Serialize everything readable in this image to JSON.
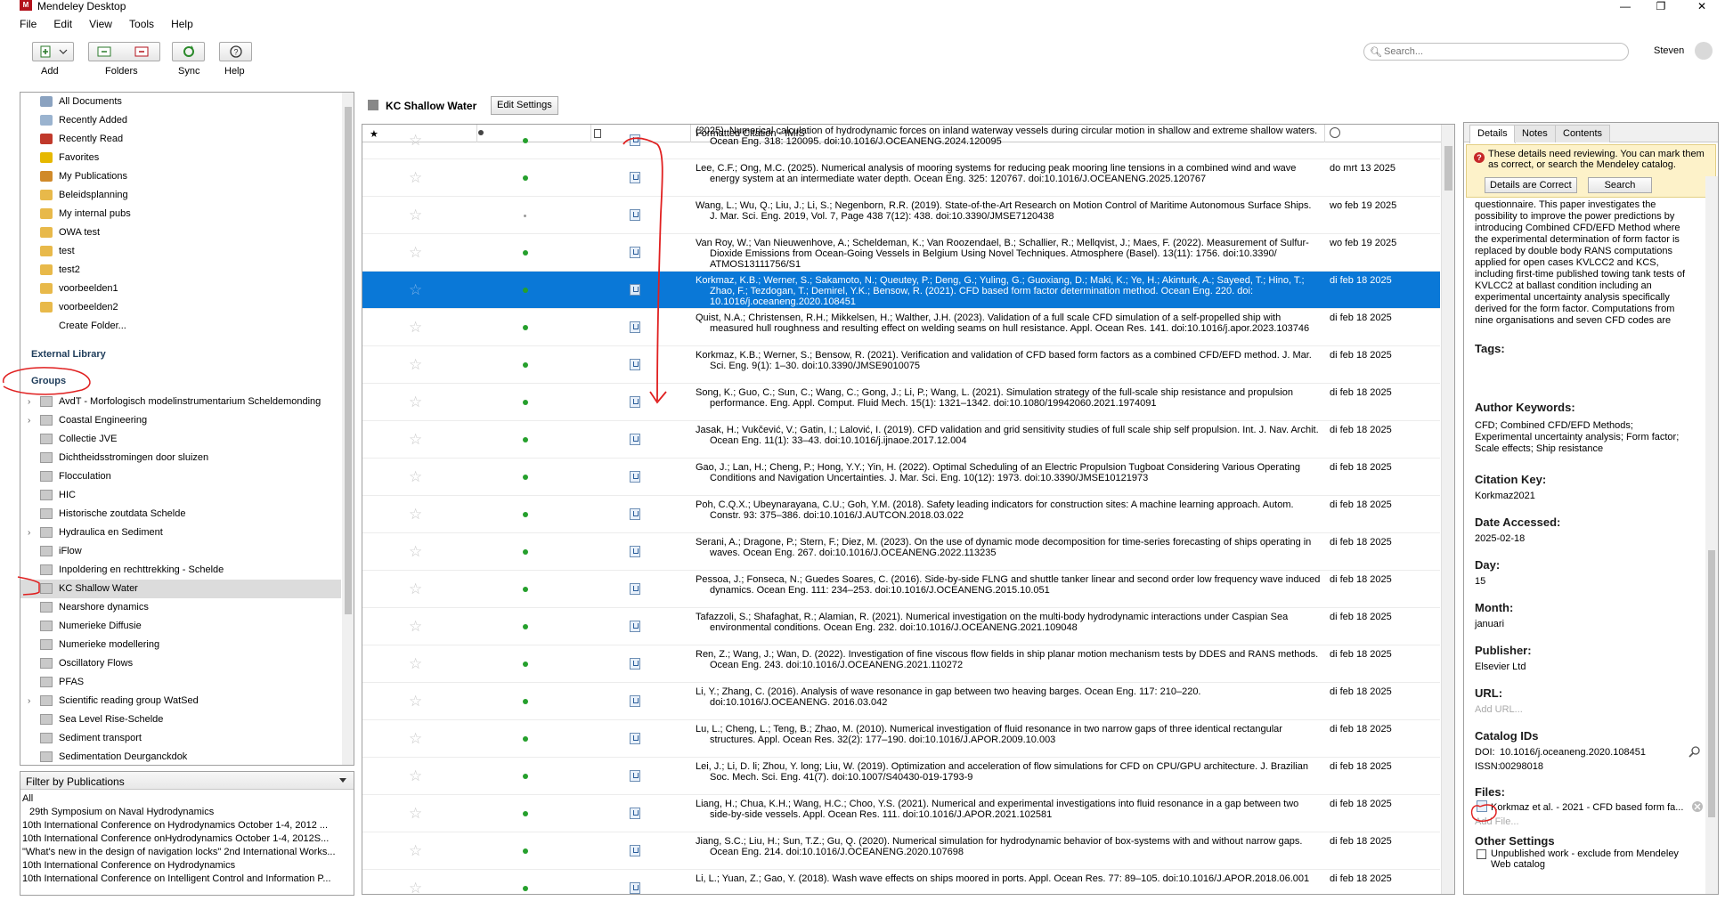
{
  "window": {
    "title": "Mendeley Desktop",
    "controls": [
      "—",
      "❐",
      "✕"
    ]
  },
  "menu": [
    "File",
    "Edit",
    "View",
    "Tools",
    "Help"
  ],
  "toolbar": {
    "add": "Add",
    "folders": "Folders",
    "sync": "Sync",
    "help": "Help"
  },
  "search": {
    "placeholder": "Search..."
  },
  "user": {
    "name": "Steven"
  },
  "sidebar": {
    "library_items": [
      {
        "label": "All Documents",
        "icon": "documents-icon"
      },
      {
        "label": "Recently Added",
        "icon": "clock-icon"
      },
      {
        "label": "Recently Read",
        "icon": "book-icon"
      },
      {
        "label": "Favorites",
        "icon": "star-icon"
      },
      {
        "label": "My Publications",
        "icon": "person-icon"
      },
      {
        "label": "Beleidsplanning",
        "icon": "folder-icon"
      },
      {
        "label": "My internal pubs",
        "icon": "folder-icon"
      },
      {
        "label": "OWA test",
        "icon": "folder-icon"
      },
      {
        "label": "test",
        "icon": "folder-icon"
      },
      {
        "label": "test2",
        "icon": "folder-icon"
      },
      {
        "label": "voorbeelden1",
        "icon": "folder-icon"
      },
      {
        "label": "voorbeelden2",
        "icon": "folder-icon"
      }
    ],
    "create_folder": "Create Folder...",
    "external_library": "External Library",
    "groups_heading": "Groups",
    "groups": [
      {
        "label": "AvdT - Morfologisch modelinstrumentarium Scheldemonding",
        "expand": true
      },
      {
        "label": "Coastal Engineering",
        "expand": true
      },
      {
        "label": "Collectie JVE",
        "expand": false
      },
      {
        "label": "Dichtheidsstromingen door sluizen",
        "expand": false
      },
      {
        "label": "Flocculation",
        "expand": false
      },
      {
        "label": "HIC",
        "expand": false
      },
      {
        "label": "Historische zoutdata Schelde",
        "expand": false
      },
      {
        "label": "Hydraulica en Sediment",
        "expand": true
      },
      {
        "label": "iFlow",
        "expand": false
      },
      {
        "label": "Inpoldering en rechttrekking - Schelde",
        "expand": false
      },
      {
        "label": "KC Shallow Water",
        "expand": false
      },
      {
        "label": "Nearshore dynamics",
        "expand": false
      },
      {
        "label": "Numerieke Diffusie",
        "expand": false
      },
      {
        "label": "Numerieke modellering",
        "expand": false
      },
      {
        "label": "Oscillatory Flows",
        "expand": false
      },
      {
        "label": "PFAS",
        "expand": false
      },
      {
        "label": "Scientific reading group WatSed",
        "expand": true
      },
      {
        "label": "Sea Level Rise-Schelde",
        "expand": false
      },
      {
        "label": "Sediment transport",
        "expand": false
      },
      {
        "label": "Sedimentation Deurganckdok",
        "expand": false
      }
    ],
    "selected_group": "KC Shallow Water"
  },
  "filter": {
    "title": "Filter by Publications",
    "items": [
      "All",
      "29th Symposium on Naval Hydrodynamics",
      "10th International Conference on Hydrodynamics   October 1-4, 2012 ...",
      "10th International Conference onHydrodynamics   October 1-4, 2012S...",
      "\"What's new in the design of navigation locks\" 2nd International Works...",
      "10th International Conference on Hydrodynamics",
      "10th International Conference on Intelligent Control and Information P..."
    ]
  },
  "center": {
    "collection_title": "KC Shallow Water",
    "edit_settings": "Edit Settings",
    "columns": {
      "citation": "Formatted Citation - IMIS"
    },
    "rows": [
      {
        "citation": "(2025). Numerical calculation of hydrodynamic forces on inland waterway vessels during circular motion in shallow and extreme shallow waters. Ocean Eng. 318: 120095. doi:10.1016/J.OCEANENG.2024.120095",
        "date": "",
        "read": "read"
      },
      {
        "citation": "Lee, C.F.; Ong, M.C. (2025). Numerical analysis of mooring systems for reducing peak mooring line tensions in a combined wind and wave energy system at an intermediate water depth. Ocean Eng. 325: 120767. doi:10.1016/J.OCEANENG.2025.120767",
        "date": "do mrt 13 2025",
        "read": "read"
      },
      {
        "citation": "Wang, L.; Wu, Q.; Liu, J.; Li, S.; Negenborn, R.R. (2019). State-of-the-Art Research on Motion Control of Maritime Autonomous Surface Ships. J. Mar. Sci. Eng. 2019, Vol. 7, Page 438 7(12): 438. doi:10.3390/JMSE7120438",
        "date": "wo feb 19 2025",
        "read": "unread"
      },
      {
        "citation": "Van Roy, W.; Van Nieuwenhove, A.; Scheldeman, K.; Van Roozendael, B.; Schallier, R.; Mellqvist, J.; Maes, F. (2022). Measurement of Sulfur-Dioxide Emissions from Ocean-Going Vessels in Belgium Using Novel Techniques. Atmosphere (Basel). 13(11): 1756. doi:10.3390/ ATMOS13111756/S1",
        "date": "wo feb 19 2025",
        "read": "read"
      },
      {
        "citation": "Korkmaz, K.B.; Werner, S.; Sakamoto, N.; Queutey, P.; Deng, G.; Yuling, G.; Guoxiang, D.; Maki, K.; Ye, H.; Akinturk, A.; Sayeed, T.; Hino, T.; Zhao, F.; Tezdogan, T.; Demirel, Y.K.; Bensow, R. (2021). CFD based form factor determination method. Ocean Eng. 220. doi: 10.1016/j.oceaneng.2020.108451",
        "date": "di feb 18 2025",
        "read": "read",
        "selected": true
      },
      {
        "citation": "Quist, N.A.; Christensen, R.H.; Mikkelsen, H.; Walther, J.H. (2023). Validation of a full scale CFD simulation of a self-propelled ship with measured hull roughness and resulting effect on welding seams on hull resistance. Appl. Ocean Res. 141. doi:10.1016/j.apor.2023.103746",
        "date": "di feb 18 2025",
        "read": "read"
      },
      {
        "citation": "Korkmaz, K.B.; Werner, S.; Bensow, R. (2021). Verification and validation of CFD based form factors as a combined CFD/EFD method. J. Mar. Sci. Eng. 9(1): 1–30. doi:10.3390/JMSE9010075",
        "date": "di feb 18 2025",
        "read": "read"
      },
      {
        "citation": "Song, K.; Guo, C.; Sun, C.; Wang, C.; Gong, J.; Li, P.; Wang, L. (2021). Simulation strategy of the full-scale ship resistance and propulsion performance. Eng. Appl. Comput. Fluid Mech. 15(1): 1321–1342. doi:10.1080/19942060.2021.1974091",
        "date": "di feb 18 2025",
        "read": "read"
      },
      {
        "citation": "Jasak, H.; Vukčević, V.; Gatin, I.; Lalović, I. (2019). CFD validation and grid sensitivity studies of full scale ship self propulsion. Int. J. Nav. Archit. Ocean Eng. 11(1): 33–43. doi:10.1016/j.ijnaoe.2017.12.004",
        "date": "di feb 18 2025",
        "read": "read"
      },
      {
        "citation": "Gao, J.; Lan, H.; Cheng, P.; Hong, Y.Y.; Yin, H. (2022). Optimal Scheduling of an Electric Propulsion Tugboat Considering Various Operating Conditions and Navigation Uncertainties. J. Mar. Sci. Eng. 10(12): 1973. doi:10.3390/JMSE10121973",
        "date": "di feb 18 2025",
        "read": "read"
      },
      {
        "citation": "Poh, C.Q.X.; Ubeynarayana, C.U.; Goh, Y.M. (2018). Safety leading indicators for construction sites: A machine learning approach. Autom. Constr. 93: 375–386. doi:10.1016/J.AUTCON.2018.03.022",
        "date": "di feb 18 2025",
        "read": "read"
      },
      {
        "citation": "Serani, A.; Dragone, P.; Stern, F.; Diez, M. (2023). On the use of dynamic mode decomposition for time-series forecasting of ships operating in waves. Ocean Eng. 267. doi:10.1016/J.OCEANENG.2022.113235",
        "date": "di feb 18 2025",
        "read": "read"
      },
      {
        "citation": "Pessoa, J.; Fonseca, N.; Guedes Soares, C. (2016). Side-by-side FLNG and shuttle tanker linear and second order low frequency wave induced dynamics. Ocean Eng. 111: 234–253. doi:10.1016/J.OCEANENG.2015.10.051",
        "date": "di feb 18 2025",
        "read": "read"
      },
      {
        "citation": "Tafazzoli, S.; Shafaghat, R.; Alamian, R. (2021). Numerical investigation on the multi-body hydrodynamic interactions under Caspian Sea environmental conditions. Ocean Eng. 232. doi:10.1016/J.OCEANENG.2021.109048",
        "date": "di feb 18 2025",
        "read": "read"
      },
      {
        "citation": "Ren, Z.; Wang, J.; Wan, D. (2022). Investigation of fine viscous flow fields in ship planar motion mechanism tests by DDES and RANS methods. Ocean Eng. 243. doi:10.1016/J.OCEANENG.2021.110272",
        "date": "di feb 18 2025",
        "read": "read"
      },
      {
        "citation": "Li, Y.; Zhang, C. (2016). Analysis of wave resonance in gap between two heaving barges. Ocean Eng. 117: 210–220. doi:10.1016/J.OCEANENG. 2016.03.042",
        "date": "di feb 18 2025",
        "read": "read"
      },
      {
        "citation": "Lu, L.; Cheng, L.; Teng, B.; Zhao, M. (2010). Numerical investigation of fluid resonance in two narrow gaps of three identical rectangular structures. Appl. Ocean Res. 32(2): 177–190. doi:10.1016/J.APOR.2009.10.003",
        "date": "di feb 18 2025",
        "read": "read"
      },
      {
        "citation": "Lei, J.; Li, D. li; Zhou, Y. long; Liu, W. (2019). Optimization and acceleration of flow simulations for CFD on CPU/GPU architecture. J. Brazilian Soc. Mech. Sci. Eng. 41(7). doi:10.1007/S40430-019-1793-9",
        "date": "di feb 18 2025",
        "read": "read"
      },
      {
        "citation": "Liang, H.; Chua, K.H.; Wang, H.C.; Choo, Y.S. (2021). Numerical and experimental investigations into fluid resonance in a gap between two side-by-side vessels. Appl. Ocean Res. 111. doi:10.1016/J.APOR.2021.102581",
        "date": "di feb 18 2025",
        "read": "read"
      },
      {
        "citation": "Jiang, S.C.; Liu, H.; Sun, T.Z.; Gu, Q. (2020). Numerical simulation for hydrodynamic behavior of box-systems with and without narrow gaps. Ocean Eng. 214. doi:10.1016/J.OCEANENG.2020.107698",
        "date": "di feb 18 2025",
        "read": "read"
      },
      {
        "citation": "Li, L.; Yuan, Z.; Gao, Y. (2018). Wash wave effects on ships moored in ports. Appl. Ocean Res. 77: 89–105. doi:10.1016/J.APOR.2018.06.001",
        "date": "di feb 18 2025",
        "read": "read"
      }
    ]
  },
  "details": {
    "tabs": [
      "Details",
      "Notes",
      "Contents"
    ],
    "active_tab": "Details",
    "warning_text": "These details need reviewing. You can mark them as correct, or search the Mendeley catalog.",
    "details_correct_btn": "Details are Correct",
    "search_btn": "Search",
    "abstract": "questionnaire. This paper investigates the possibility to improve the power predictions by introducing Combined CFD/EFD Method where the experimental determination of form factor is replaced by double body RANS computations applied for open cases KVLCC2 and KCS, including first-time published towing tank tests of KVLCC2 at ballast condition including an experimental uncertainty analysis specifically derived for the form factor. Computations from nine organisations and seven CFD codes are compared to the experiments. The form fact...",
    "tags_label": "Tags:",
    "keywords_label": "Author Keywords:",
    "keywords": "CFD; Combined CFD/EFD Methods; Experimental uncertainty analysis; Form factor; Scale effects; Ship resistance",
    "citation_key_label": "Citation Key:",
    "citation_key": "Korkmaz2021",
    "date_accessed_label": "Date Accessed:",
    "date_accessed": "2025-02-18",
    "day_label": "Day:",
    "day": "15",
    "month_label": "Month:",
    "month": "januari",
    "publisher_label": "Publisher:",
    "publisher": "Elsevier Ltd",
    "url_label": "URL:",
    "url_placeholder": "Add URL...",
    "catalog_label": "Catalog IDs",
    "doi_label": "DOI:",
    "doi": "10.1016/j.oceaneng.2020.108451",
    "issn_label": "ISSN:",
    "issn": "00298018",
    "files_label": "Files:",
    "file_name": "Korkmaz et al. - 2021 - CFD based form fa...",
    "add_file": "Add File...",
    "other_label": "Other Settings",
    "unpublished": "Unpublished work - exclude from Mendeley Web catalog"
  }
}
